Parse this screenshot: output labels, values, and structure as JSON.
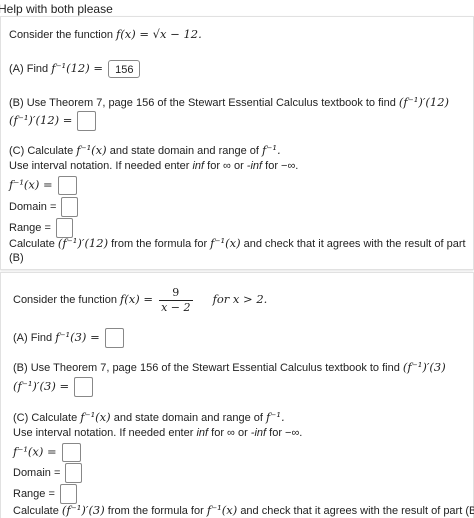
{
  "title": "Help with both please",
  "p1": {
    "intro": "Consider the function",
    "f_def": "f(x) = √x − 12.",
    "a_label": "(A) Find",
    "a_expr": "f⁻¹(12) =",
    "a_answer": "156",
    "b_text": "(B) Use Theorem 7, page 156 of the Stewart Essential Calculus textbook to find",
    "b_expr_inline": "(f⁻¹)′(12)",
    "b_expr": "(f⁻¹)′(12) =",
    "c_text_a": "(C) Calculate",
    "c_expr_a": "f⁻¹(x)",
    "c_text_b": "and state domain and range of",
    "c_expr_b": "f⁻¹.",
    "interval_note_a": "Use interval notation. If needed enter",
    "inf": "inf",
    "interval_note_b": "for ∞ or",
    "neg_inf": "-inf",
    "interval_note_c": "for −∞.",
    "finv_label": "f⁻¹(x) =",
    "domain_label": "Domain =",
    "range_label": "Range =",
    "calc_text_a": "Calculate",
    "calc_expr_a": "(f⁻¹)′(12)",
    "calc_text_b": "from the formula for",
    "calc_expr_b": "f⁻¹(x)",
    "calc_text_c": "and check that it agrees with the result of part",
    "calc_text_d": "(B)"
  },
  "p2": {
    "intro": "Consider the function",
    "f_lhs": "f(x) =",
    "frac_num": "9",
    "frac_den": "x − 2",
    "cond": "for x > 2.",
    "a_label": "(A) Find",
    "a_expr": "f⁻¹(3) =",
    "b_text": "(B) Use Theorem 7, page 156 of the Stewart Essential Calculus textbook to find",
    "b_expr_inline": "(f⁻¹)′(3)",
    "b_expr": "(f⁻¹)′(3) =",
    "c_text_a": "(C) Calculate",
    "c_expr_a": "f⁻¹(x)",
    "c_text_b": "and state domain and range of",
    "c_expr_b": "f⁻¹.",
    "interval_note_a": "Use interval notation. If needed enter",
    "inf": "inf",
    "interval_note_b": "for ∞ or",
    "neg_inf": "-inf",
    "interval_note_c": "for −∞.",
    "finv_label": "f⁻¹(x) =",
    "domain_label": "Domain =",
    "range_label": "Range =",
    "calc_text_a": "Calculate",
    "calc_expr_a": "(f⁻¹)′(3)",
    "calc_text_b": "from the formula for",
    "calc_expr_b": "f⁻¹(x)",
    "calc_text_c": "and check that it agrees with the result of part (B)"
  }
}
